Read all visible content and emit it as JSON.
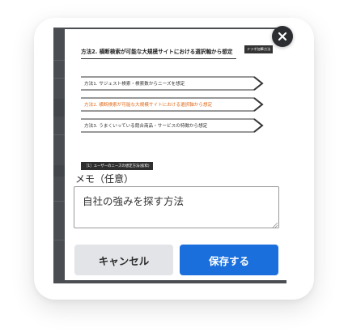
{
  "article_image": {
    "title": "方法2. 横断検索が可能な大規模サイトにおける選択軸から想定",
    "tag": "ドツボ加筆方法",
    "methods": [
      {
        "label": "方法1. サジェスト検索・検索数からニーズを想定",
        "active": false
      },
      {
        "label": "方法2. 横断検索が可能な大規模サイトにおける選択軸から想定",
        "active": true
      },
      {
        "label": "方法3. うまくいっている競合商品・サービスの特徴から想定",
        "active": false
      }
    ],
    "note": "［1］ユーザーのニーズの想定方法(抜粋)"
  },
  "memo": {
    "label": "メモ（任意）",
    "value": "自社の強みを探す方法"
  },
  "buttons": {
    "cancel": "キャンセル",
    "save": "保存する"
  },
  "colors": {
    "primary": "#1a6fdc",
    "active_method": "#e06a1c",
    "backdrop": "#4a4d52"
  }
}
